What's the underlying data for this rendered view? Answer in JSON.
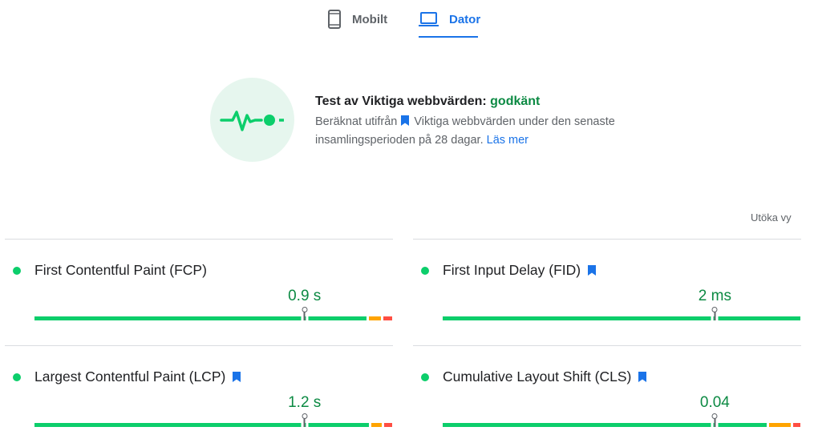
{
  "tabs": [
    {
      "label": "Mobilt",
      "icon": "smartphone-icon",
      "active": false
    },
    {
      "label": "Dator",
      "icon": "laptop-icon",
      "active": true
    }
  ],
  "summary": {
    "icon": "core-web-vitals-pulse-icon",
    "title_prefix": "Test av Viktiga webbvärden: ",
    "status": "godkänt",
    "desc_before": "Beräknat utifrån",
    "desc_after": "Viktiga webbvärden under den senaste insamlingsperioden på 28 dagar.",
    "link": "Läs mer"
  },
  "expand_view": "Utöka vy",
  "metrics": [
    {
      "name": "First Contentful Paint (FCP)",
      "value": "0.9 s",
      "core_vital": false,
      "status": "good",
      "marker_position": 0.755
    },
    {
      "name": "First Input Delay (FID)",
      "value": "2 ms",
      "core_vital": true,
      "status": "good",
      "marker_position": 0.761
    },
    {
      "name": "Largest Contentful Paint (LCP)",
      "value": "1.2 s",
      "core_vital": true,
      "status": "good",
      "marker_position": 0.755
    },
    {
      "name": "Cumulative Layout Shift (CLS)",
      "value": "0.04",
      "core_vital": true,
      "status": "good",
      "marker_position": 0.761
    }
  ],
  "distribution": [
    {
      "good": 0.935,
      "needs_improvement": 0.04,
      "poor": 0.025
    },
    {
      "good": 1.0,
      "needs_improvement": 0.0,
      "poor": 0.0
    },
    {
      "good": 0.942,
      "needs_improvement": 0.035,
      "poor": 0.023
    },
    {
      "good": 0.913,
      "needs_improvement": 0.066,
      "poor": 0.021
    }
  ],
  "colors": {
    "good": "#0cce6b",
    "needs_improvement": "#ffa400",
    "poor": "#ff4e42",
    "accent": "#1a73e8",
    "pass_text": "#0c8a43"
  }
}
